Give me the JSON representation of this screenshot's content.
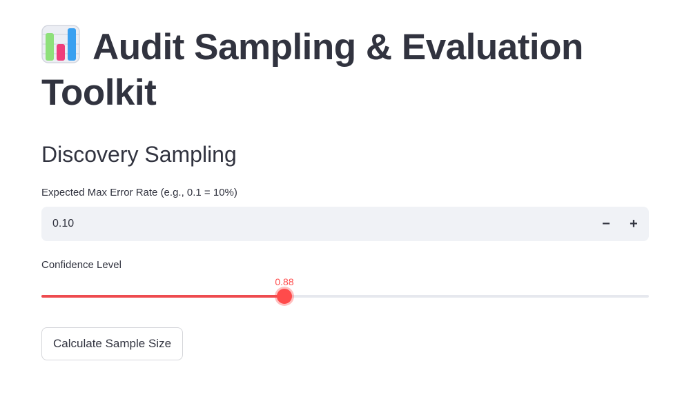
{
  "page": {
    "title": "Audit Sampling & Evaluation Toolkit",
    "title_icon": "bar-chart-icon"
  },
  "discovery": {
    "subheader": "Discovery Sampling",
    "error_rate": {
      "label": "Expected Max Error Rate (e.g., 0.1 = 10%)",
      "value": "0.10",
      "decrement_label": "−",
      "increment_label": "+"
    },
    "confidence": {
      "label": "Confidence Level",
      "value": 0.88,
      "value_text": "0.88",
      "fraction": 0.4
    },
    "calculate_button": "Calculate Sample Size"
  },
  "colors": {
    "accent": "#ff4b4b",
    "text": "#31333f",
    "input_bg": "#f0f2f6"
  }
}
